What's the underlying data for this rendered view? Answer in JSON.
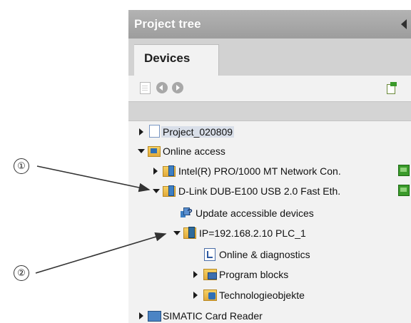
{
  "panel": {
    "title": "Project tree"
  },
  "tabs": [
    {
      "label": "Devices"
    }
  ],
  "tree": {
    "project": "Project_020809",
    "online_access": "Online access",
    "intel_adapter": "Intel(R) PRO/1000 MT Network Con.",
    "dlink_adapter": "D-Link DUB-E100 USB 2.0 Fast Eth.",
    "update_devices": "Update accessible devices",
    "plc_node": "IP=192.168.2.10 PLC_1",
    "online_diag": "Online & diagnostics",
    "program_blocks": "Program blocks",
    "tech_objects": "Technologieobjekte",
    "card_reader": "SIMATIC Card Reader"
  },
  "callouts": [
    {
      "number": "①"
    },
    {
      "number": "②"
    }
  ],
  "colors": {
    "header": "#a6a6a6",
    "panel_bg": "#f2f2f2",
    "tab_strip": "#d2d2d2",
    "callout_line": "#333333"
  }
}
